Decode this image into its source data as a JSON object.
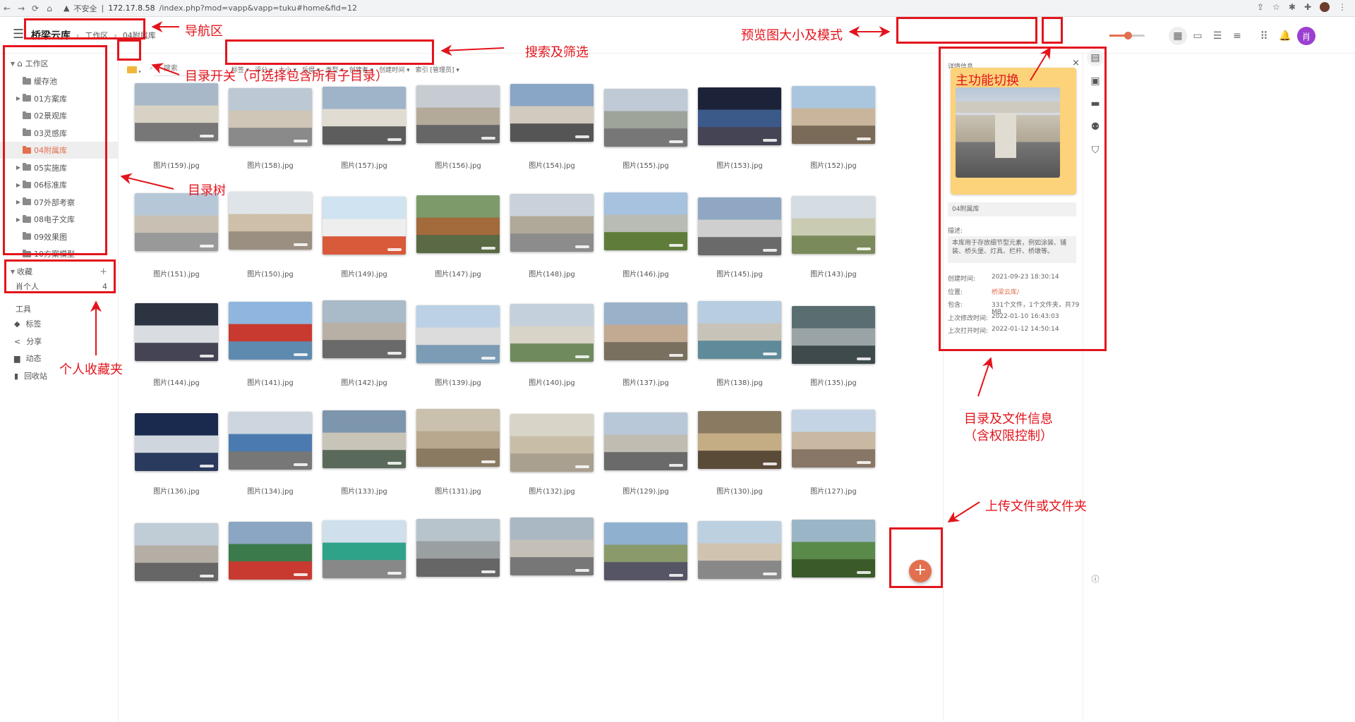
{
  "browser": {
    "insecure_label": "不安全",
    "url_host": "172.17.8.58",
    "url_path": "/index.php?mod=vapp&vapp=tuku#home&fid=12"
  },
  "header": {
    "breadcrumb_root": "桥梁云库",
    "breadcrumb_items": [
      "工作区",
      "04附属库"
    ],
    "avatar_text": "肖"
  },
  "sidebar": {
    "root_label": "工作区",
    "items": [
      {
        "label": "缓存池",
        "expandable": false,
        "active": false
      },
      {
        "label": "01方案库",
        "expandable": true,
        "active": false
      },
      {
        "label": "02景观库",
        "expandable": false,
        "active": false
      },
      {
        "label": "03灵感库",
        "expandable": false,
        "active": false
      },
      {
        "label": "04附属库",
        "expandable": false,
        "active": true
      },
      {
        "label": "05实施库",
        "expandable": true,
        "active": false
      },
      {
        "label": "06标准库",
        "expandable": true,
        "active": false
      },
      {
        "label": "07外部考察",
        "expandable": true,
        "active": false
      },
      {
        "label": "08电子文库",
        "expandable": true,
        "active": false
      },
      {
        "label": "09效果图",
        "expandable": false,
        "active": false
      },
      {
        "label": "10方案模型",
        "expandable": false,
        "active": false
      }
    ],
    "favorites_label": "收藏",
    "favorites_add": "+",
    "favorite_item": {
      "label": "肖个人",
      "count": "4"
    },
    "tools_label": "工具",
    "tools": [
      "标签",
      "分享",
      "动态",
      "回收站"
    ]
  },
  "filterbar": {
    "search_placeholder": "搜索",
    "filters": [
      "标签",
      "评分",
      "大小",
      "后缀",
      "类型",
      "创建者",
      "创建时间",
      "索引 [管理员]"
    ]
  },
  "thumbnails": [
    "图片(159).jpg",
    "图片(158).jpg",
    "图片(157).jpg",
    "图片(156).jpg",
    "图片(154).jpg",
    "图片(155).jpg",
    "图片(153).jpg",
    "图片(152).jpg",
    "图片(151).jpg",
    "图片(150).jpg",
    "图片(149).jpg",
    "图片(147).jpg",
    "图片(148).jpg",
    "图片(146).jpg",
    "图片(145).jpg",
    "图片(143).jpg",
    "图片(144).jpg",
    "图片(141).jpg",
    "图片(142).jpg",
    "图片(139).jpg",
    "图片(140).jpg",
    "图片(137).jpg",
    "图片(138).jpg",
    "图片(135).jpg",
    "图片(136).jpg",
    "图片(134).jpg",
    "图片(133).jpg",
    "图片(131).jpg",
    "图片(132).jpg",
    "图片(129).jpg",
    "图片(130).jpg",
    "图片(127).jpg",
    "",
    "",
    "",
    "",
    "",
    "",
    "",
    ""
  ],
  "detail": {
    "title": "详情信息",
    "close": "×",
    "folder_name": "04附属库",
    "desc_label": "描述:",
    "desc_text": "本库用于存放细节型元素，例如涂装、铺装、桥头堡、灯具、栏杆、桥墩等。",
    "rows": [
      {
        "label": "创建时间:",
        "value": "2021-09-23 18:30:14"
      },
      {
        "label": "位置:",
        "value": "桥梁云库/"
      },
      {
        "label": "包含:",
        "value": "331个文件，1个文件夹，共79 MB"
      },
      {
        "label": "上次修改时间:",
        "value": "2022-01-10 16:43:03"
      },
      {
        "label": "上次打开时间:",
        "value": "2022-01-12 14:50:14"
      }
    ]
  },
  "fab_label": "+",
  "annotations": {
    "nav": "导航区",
    "preview": "预览图大小及模式",
    "search": "搜索及筛选",
    "dir_switch": "目录开关（可选择包含所有子目录）",
    "main_switch": "主功能切换",
    "tree": "目录树",
    "favorites": "个人收藏夹",
    "info_line1": "目录及文件信息",
    "info_line2": "（含权限控制）",
    "upload": "上传文件或文件夹"
  },
  "colors": {
    "accent": "#e2704f",
    "annotation": "#e3141c",
    "avatar": "#9b3fd0",
    "highlight_card": "#fcd27a"
  }
}
